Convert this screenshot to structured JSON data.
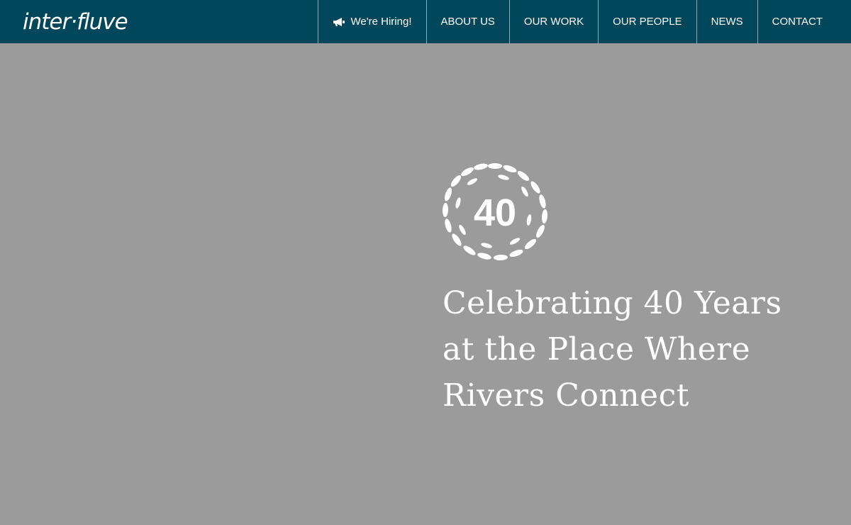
{
  "brand": {
    "logo_text": "inter·fluve"
  },
  "nav": {
    "hiring": {
      "label": "We're Hiring!",
      "icon": "megaphone-icon"
    },
    "items": [
      {
        "label": "ABOUT US"
      },
      {
        "label": "OUR WORK"
      },
      {
        "label": "OUR PEOPLE"
      },
      {
        "label": "NEWS"
      },
      {
        "label": "CONTACT"
      }
    ]
  },
  "hero": {
    "badge_text": "40",
    "headline_lines": [
      "Celebrating 40 Years",
      "at the Place Where",
      "Rivers Connect"
    ]
  },
  "colors": {
    "header_bg": "#01475b",
    "hero_bg": "#9b9b9b",
    "text": "#ffffff"
  }
}
